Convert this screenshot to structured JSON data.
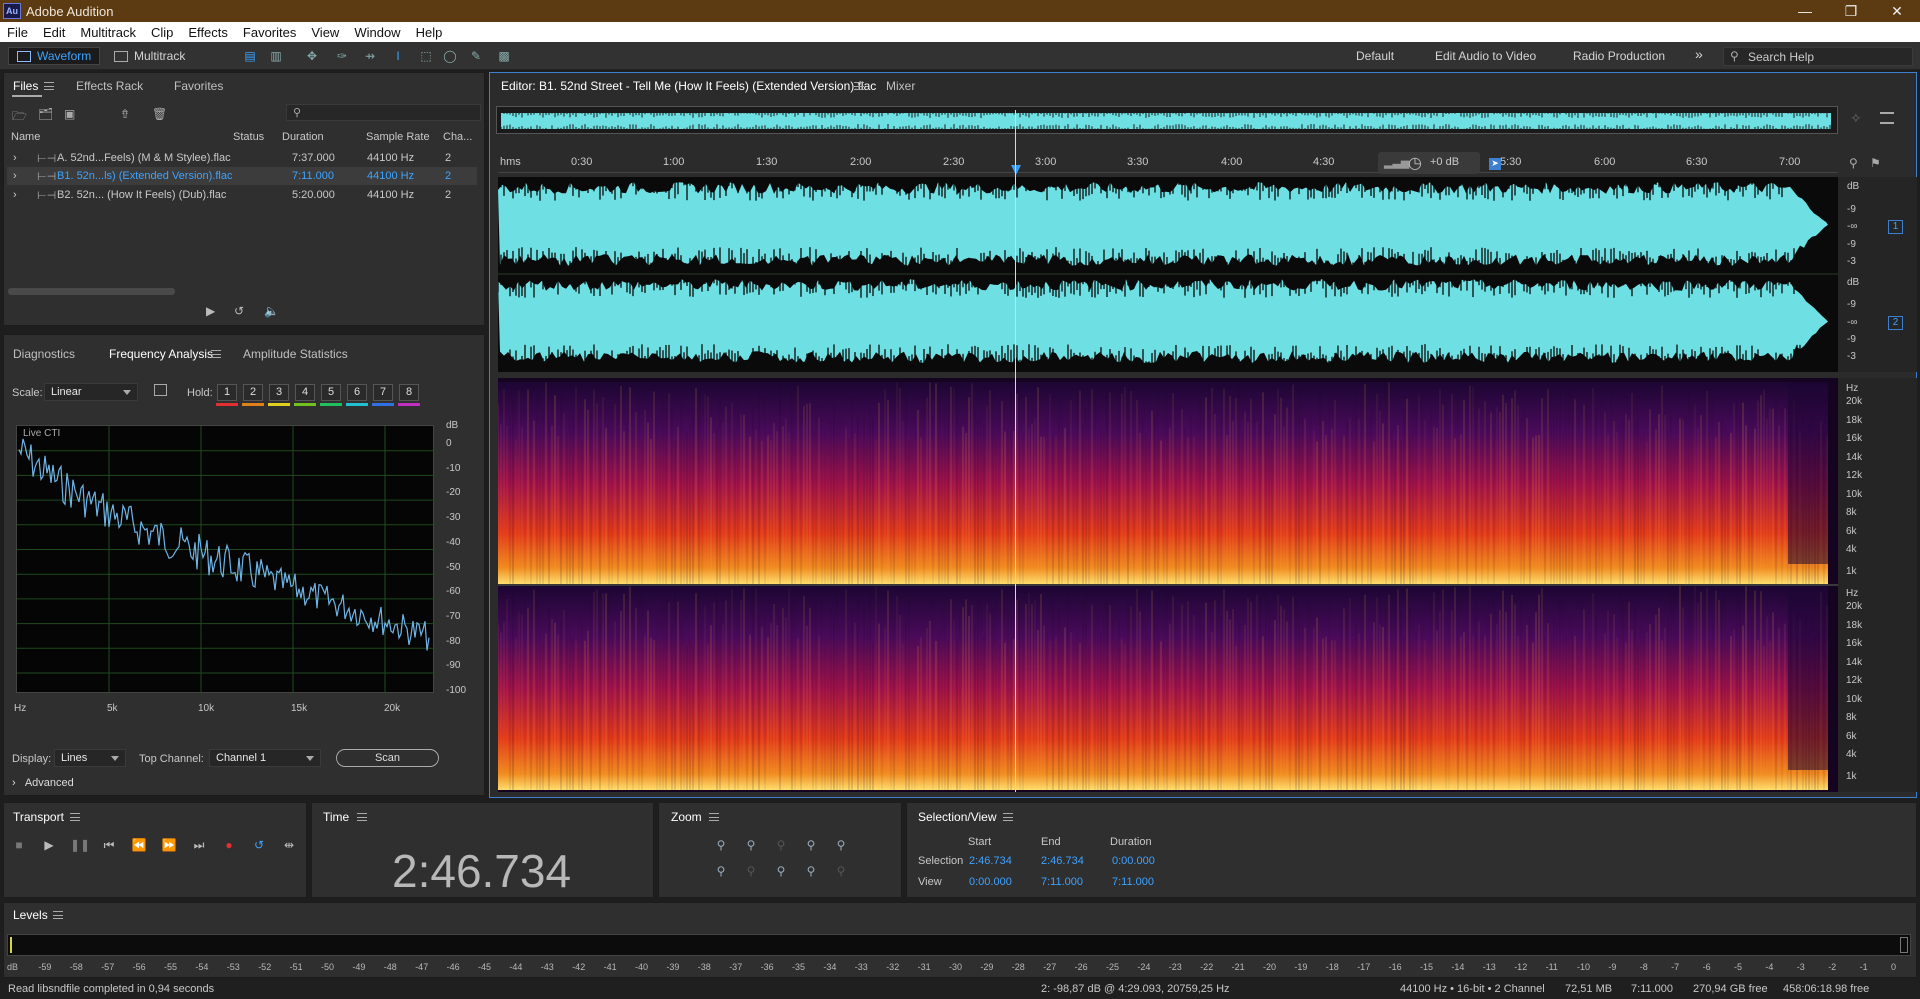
{
  "app": {
    "title": "Adobe Audition",
    "icon": "Au"
  },
  "menu": [
    "File",
    "Edit",
    "Multitrack",
    "Clip",
    "Effects",
    "Favorites",
    "View",
    "Window",
    "Help"
  ],
  "toolbar": {
    "waveform": "Waveform",
    "multitrack": "Multitrack",
    "workspaces": [
      "Default",
      "Edit Audio to Video",
      "Radio Production"
    ],
    "overflow": "»",
    "search": "Search Help"
  },
  "files": {
    "tabs": [
      "Files",
      "Effects Rack",
      "Favorites"
    ],
    "columns": [
      "Name",
      "Status",
      "Duration",
      "Sample Rate",
      "Cha..."
    ],
    "rows": [
      {
        "name": "A. 52nd...Feels) (M & M Stylee).flac",
        "duration": "7:37.000",
        "rate": "44100 Hz",
        "ch": "2"
      },
      {
        "name": "B1. 52n...ls) (Extended Version).flac",
        "duration": "7:11.000",
        "rate": "44100 Hz",
        "ch": "2"
      },
      {
        "name": "B2. 52n... (How It Feels) (Dub).flac",
        "duration": "5:20.000",
        "rate": "44100 Hz",
        "ch": "2"
      }
    ]
  },
  "analysis": {
    "tabs": [
      "Diagnostics",
      "Frequency Analysis",
      "Amplitude Statistics"
    ],
    "scale_label": "Scale:",
    "scale": "Linear",
    "hold_label": "Hold:",
    "holds": [
      "1",
      "2",
      "3",
      "4",
      "5",
      "6",
      "7",
      "8"
    ],
    "hold_colors": [
      "#e03030",
      "#e0801a",
      "#e0d020",
      "#70c020",
      "#20c060",
      "#20c0d0",
      "#3070e0",
      "#c030c0"
    ],
    "live": "Live CTI",
    "db_unit": "dB",
    "db_ticks": [
      "0",
      "-10",
      "-20",
      "-30",
      "-40",
      "-50",
      "-60",
      "-70",
      "-80",
      "-90",
      "-100"
    ],
    "hz_ticks": [
      "Hz",
      "5k",
      "10k",
      "15k",
      "20k"
    ],
    "display_label": "Display:",
    "display": "Lines",
    "top_channel_label": "Top Channel:",
    "top_channel": "Channel 1",
    "scan": "Scan",
    "advanced": "Advanced"
  },
  "editor": {
    "tab": "Editor: B1. 52nd Street - Tell Me (How It Feels) (Extended Version).flac",
    "mixer": "Mixer",
    "ruler": [
      "hms",
      "0:30",
      "1:00",
      "1:30",
      "2:00",
      "2:30",
      "3:00",
      "3:30",
      "4:00",
      "4:30",
      "5:30",
      "6:00",
      "6:30",
      "7:00"
    ],
    "gain": "+0 dB",
    "db_unit": "dB",
    "db_ticks": [
      "-9",
      "-∞",
      "-9",
      "-3"
    ],
    "channels": [
      "1",
      "2"
    ],
    "hz_unit": "Hz",
    "hz_ticks": [
      "20k",
      "18k",
      "16k",
      "14k",
      "12k",
      "10k",
      "8k",
      "6k",
      "4k",
      "1k"
    ]
  },
  "transport": {
    "title": "Transport"
  },
  "time": {
    "title": "Time",
    "value": "2:46.734"
  },
  "zoom": {
    "title": "Zoom"
  },
  "selection": {
    "title": "Selection/View",
    "start": "Start",
    "end": "End",
    "duration": "Duration",
    "sel_label": "Selection",
    "view_label": "View",
    "sel_start": "2:46.734",
    "sel_end": "2:46.734",
    "sel_dur": "0:00.000",
    "view_start": "0:00.000",
    "view_end": "7:11.000",
    "view_dur": "7:11.000"
  },
  "levels": {
    "title": "Levels",
    "ticks": [
      "dB",
      "-59",
      "-58",
      "-57",
      "-56",
      "-55",
      "-54",
      "-53",
      "-52",
      "-51",
      "-50",
      "-49",
      "-48",
      "-47",
      "-46",
      "-45",
      "-44",
      "-43",
      "-42",
      "-41",
      "-40",
      "-39",
      "-38",
      "-37",
      "-36",
      "-35",
      "-34",
      "-33",
      "-32",
      "-31",
      "-30",
      "-29",
      "-28",
      "-27",
      "-26",
      "-25",
      "-24",
      "-23",
      "-22",
      "-21",
      "-20",
      "-19",
      "-18",
      "-17",
      "-16",
      "-15",
      "-14",
      "-13",
      "-12",
      "-11",
      "-10",
      "-9",
      "-8",
      "-7",
      "-6",
      "-5",
      "-4",
      "-3",
      "-2",
      "-1",
      "0"
    ]
  },
  "status": {
    "left": "Read libsndfile completed in 0,94 seconds",
    "cursor": "2: -98,87 dB @ 4:29.093, 20759,25 Hz",
    "format": "44100 Hz • 16-bit • 2 Channel",
    "size": "72,51 MB",
    "length": "7:11.000",
    "free": "270,94 GB free",
    "free_time": "458:06:18.98 free"
  }
}
